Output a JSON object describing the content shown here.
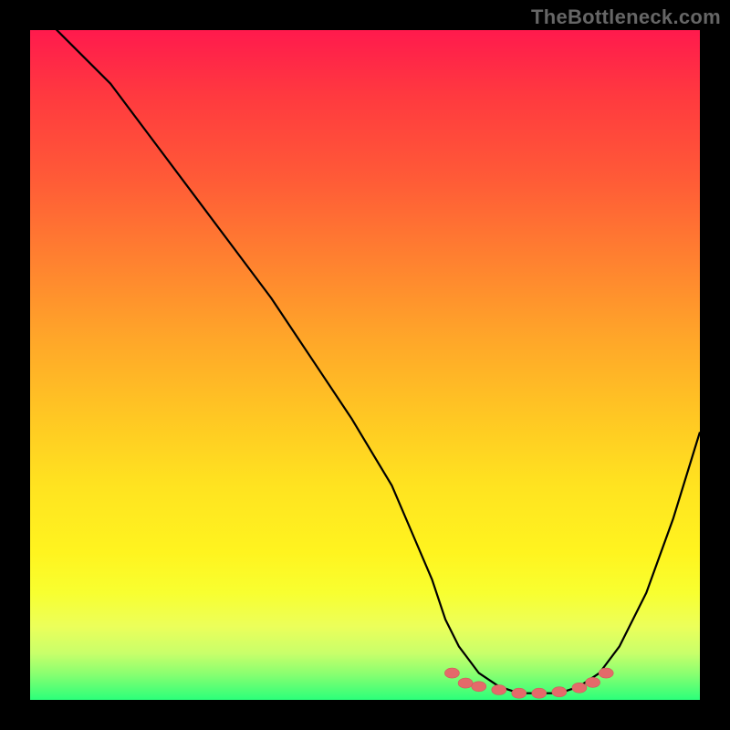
{
  "watermark": "TheBottleneck.com",
  "colors": {
    "background": "#000000",
    "gradient_top": "#ff1a4d",
    "gradient_bottom": "#2bff7a",
    "curve": "#000000",
    "markers": "#e46a6a"
  },
  "chart_data": {
    "type": "line",
    "title": "",
    "xlabel": "",
    "ylabel": "",
    "xlim": [
      0,
      100
    ],
    "ylim": [
      0,
      100
    ],
    "grid": false,
    "legend": false,
    "series": [
      {
        "name": "curve",
        "x": [
          0,
          6,
          12,
          18,
          24,
          30,
          36,
          42,
          48,
          54,
          57,
          60,
          62,
          64,
          67,
          70,
          73,
          76,
          79,
          82,
          85,
          88,
          92,
          96,
          100
        ],
        "y": [
          104,
          98,
          92,
          84,
          76,
          68,
          60,
          51,
          42,
          32,
          25,
          18,
          12,
          8,
          4,
          2,
          1,
          1,
          1,
          2,
          4,
          8,
          16,
          27,
          40
        ]
      }
    ],
    "markers": {
      "name": "min-region",
      "x": [
        63,
        65,
        67,
        70,
        73,
        76,
        79,
        82,
        84,
        86
      ],
      "y": [
        4,
        2.5,
        2,
        1.5,
        1,
        1,
        1.2,
        1.8,
        2.6,
        4
      ]
    }
  }
}
